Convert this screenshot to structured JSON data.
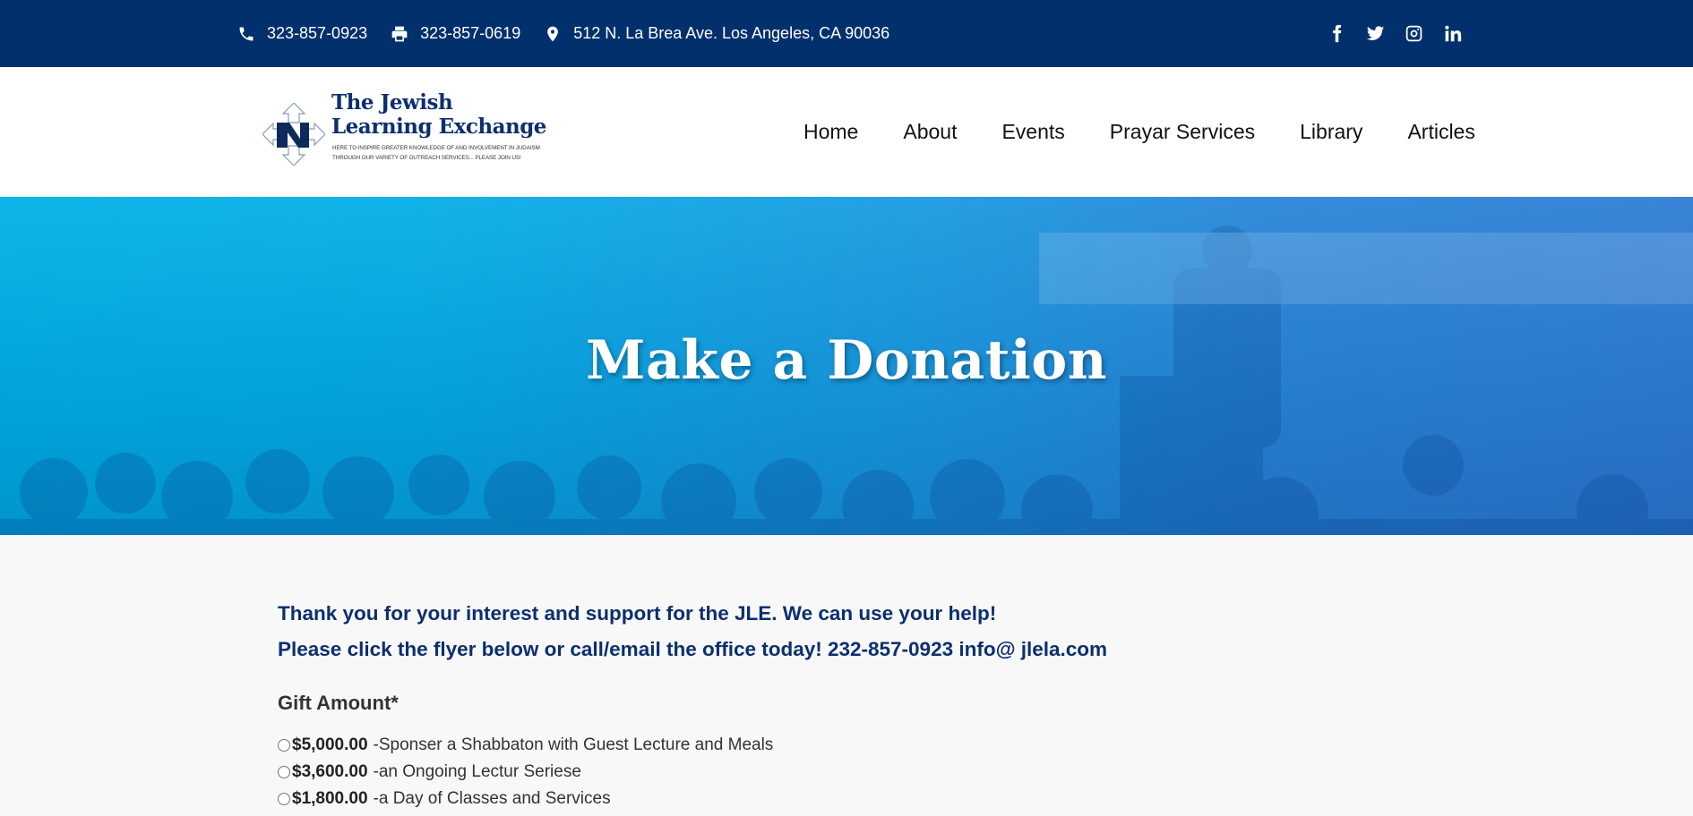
{
  "topbar": {
    "phone": "323-857-0923",
    "fax": "323-857-0619",
    "address": "512 N. La Brea Ave. Los Angeles, CA 90036",
    "icons": {
      "phone": "phone-icon",
      "fax": "printer-icon",
      "address": "map-pin-icon"
    },
    "social": [
      "facebook-icon",
      "twitter-icon",
      "instagram-icon",
      "linkedin-icon"
    ]
  },
  "logo": {
    "line1": "The Jewish",
    "line2": "Learning Exchange",
    "tagline1": "HERE TO INSPIRE GREATER KNOWLEDGE OF AND INVOLVEMENT IN JUDAISM",
    "tagline2": "THROUGH OUR VARIETY OF OUTREACH SERVICES... PLEASE JOIN US!"
  },
  "nav": {
    "items": [
      "Home",
      "About",
      "Events",
      "Prayar Services",
      "Library",
      "Articles"
    ]
  },
  "hero": {
    "title": "Make a Donation"
  },
  "content": {
    "lead1": "Thank you for your interest and support for the JLE. We can use your help!",
    "lead2": "Please click the flyer below or call/email the office today! 232-857-0923 info@ jlela.com",
    "gift_title": "Gift Amount*",
    "options": [
      {
        "amount": "$5,000.00",
        "desc": "-Sponser a Shabbaton with Guest Lecture and Meals"
      },
      {
        "amount": "$3,600.00",
        "desc": "-an Ongoing Lectur Seriese"
      },
      {
        "amount": "$1,800.00",
        "desc": "-a Day of Classes and Services"
      }
    ]
  },
  "colors": {
    "topbar": "#02306d",
    "heading": "#0c2f6e",
    "hero": "#00b2e6"
  }
}
